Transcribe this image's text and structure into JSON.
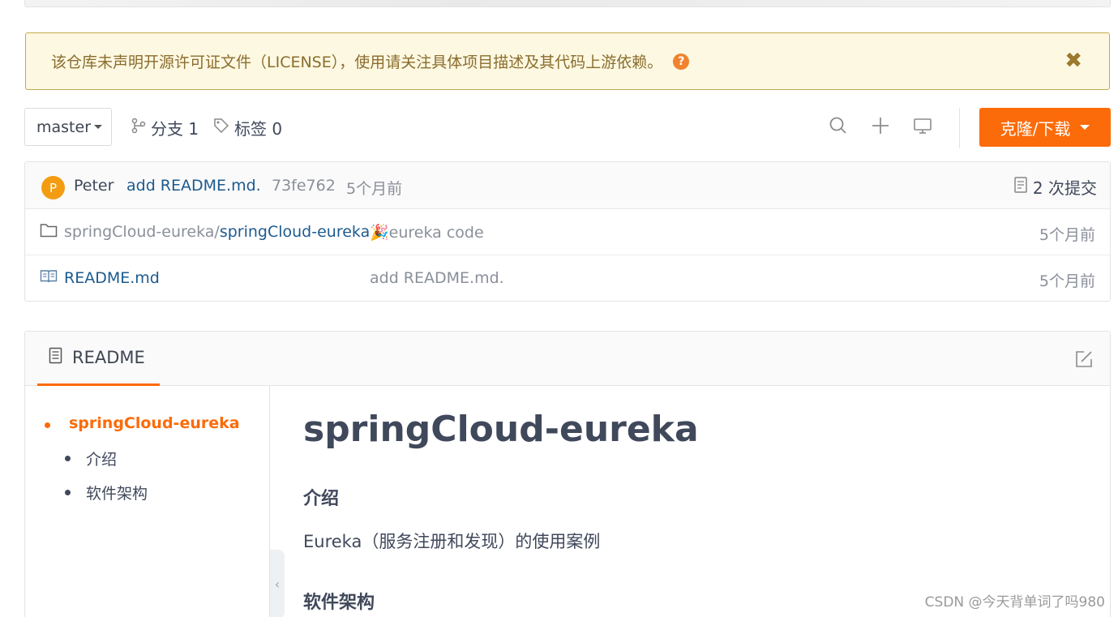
{
  "notice": {
    "text": "该仓库未声明开源许可证文件（LICENSE），使用请关注具体项目描述及其代码上游依赖。",
    "help_icon": "?",
    "close_icon": "✖"
  },
  "toolbar": {
    "branch": "master",
    "branches_label": "分支 1",
    "tags_label": "标签 0",
    "clone_label": "克隆/下载"
  },
  "commit": {
    "avatar_letter": "P",
    "author": "Peter",
    "message": "add README.md.",
    "sha": "73fe762",
    "time": "5个月前",
    "count_label": "2 次提交"
  },
  "files": [
    {
      "icon": "folder-icon",
      "name_prefix": "springCloud-eureka/",
      "name_link": "springCloud-eureka",
      "message": "🎉eureka code",
      "time": "5个月前"
    },
    {
      "icon": "book-icon",
      "name_prefix": "",
      "name_link": "README.md",
      "message": "add README.md.",
      "time": "5个月前"
    }
  ],
  "readme": {
    "tab_label": "README",
    "toc": [
      {
        "label": "springCloud-eureka",
        "active": true
      },
      {
        "label": "介绍",
        "active": false
      },
      {
        "label": "软件架构",
        "active": false
      }
    ],
    "title": "springCloud-eureka",
    "section1": "介绍",
    "section1_text": "Eureka（服务注册和发现）的使用案例",
    "section2": "软件架构"
  },
  "watermark": "CSDN @今天背单词了吗980",
  "colors": {
    "accent": "#fc6b09",
    "link": "#1d5a8e",
    "notice_bg": "#fdf8e1",
    "notice_border": "#c5a94d"
  }
}
